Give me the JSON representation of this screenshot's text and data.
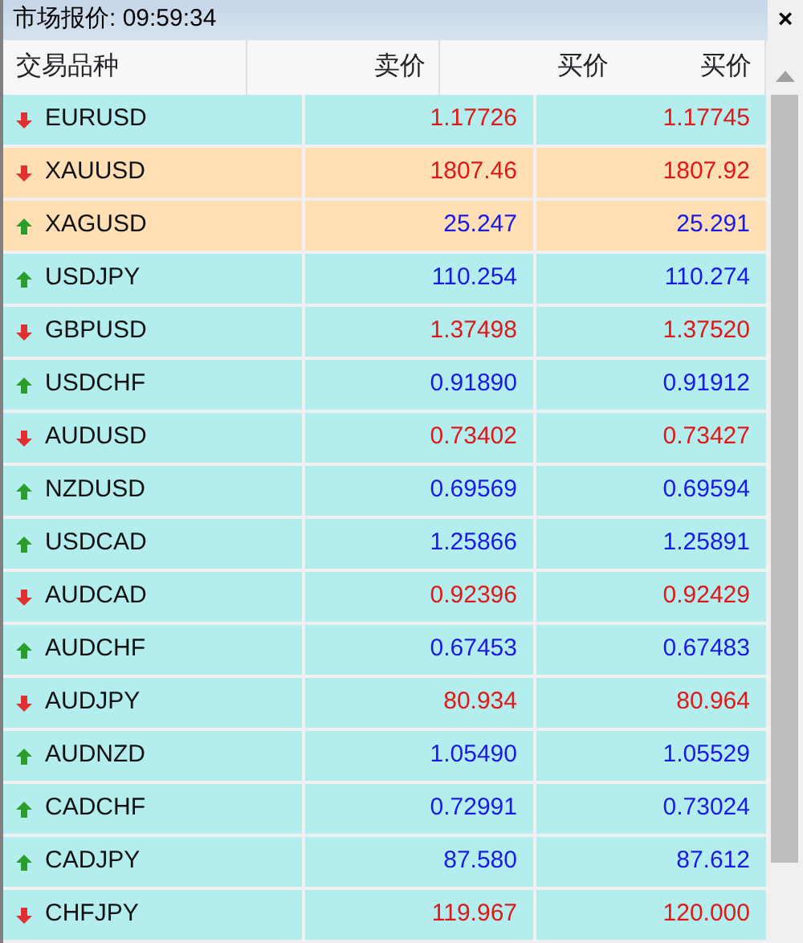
{
  "window": {
    "title": "市场报价: 09:59:34",
    "close": "×"
  },
  "columns": [
    "交易品种",
    "卖价",
    "买价",
    "买价"
  ],
  "rows": [
    {
      "symbol": "EURUSD",
      "kind": "down",
      "highlighted": false,
      "bid": "1.17726",
      "ask": "1.17745"
    },
    {
      "symbol": "XAUUSD",
      "kind": "down",
      "highlighted": true,
      "bid": "1807.46",
      "ask": "1807.92"
    },
    {
      "symbol": "XAGUSD",
      "kind": "up",
      "highlighted": true,
      "bid": "25.247",
      "ask": "25.291"
    },
    {
      "symbol": "USDJPY",
      "kind": "up",
      "highlighted": false,
      "bid": "110.254",
      "ask": "110.274"
    },
    {
      "symbol": "GBPUSD",
      "kind": "down",
      "highlighted": false,
      "bid": "1.37498",
      "ask": "1.37520"
    },
    {
      "symbol": "USDCHF",
      "kind": "up",
      "highlighted": false,
      "bid": "0.91890",
      "ask": "0.91912"
    },
    {
      "symbol": "AUDUSD",
      "kind": "down",
      "highlighted": false,
      "bid": "0.73402",
      "ask": "0.73427"
    },
    {
      "symbol": "NZDUSD",
      "kind": "up",
      "highlighted": false,
      "bid": "0.69569",
      "ask": "0.69594"
    },
    {
      "symbol": "USDCAD",
      "kind": "up",
      "highlighted": false,
      "bid": "1.25866",
      "ask": "1.25891"
    },
    {
      "symbol": "AUDCAD",
      "kind": "down",
      "highlighted": false,
      "bid": "0.92396",
      "ask": "0.92429"
    },
    {
      "symbol": "AUDCHF",
      "kind": "up",
      "highlighted": false,
      "bid": "0.67453",
      "ask": "0.67483"
    },
    {
      "symbol": "AUDJPY",
      "kind": "down",
      "highlighted": false,
      "bid": "80.934",
      "ask": "80.964"
    },
    {
      "symbol": "AUDNZD",
      "kind": "up",
      "highlighted": false,
      "bid": "1.05490",
      "ask": "1.05529"
    },
    {
      "symbol": "CADCHF",
      "kind": "up",
      "highlighted": false,
      "bid": "0.72991",
      "ask": "0.73024"
    },
    {
      "symbol": "CADJPY",
      "kind": "up",
      "highlighted": false,
      "bid": "87.580",
      "ask": "87.612"
    },
    {
      "symbol": "CHFJPY",
      "kind": "down",
      "highlighted": false,
      "bid": "119.967",
      "ask": "120.000"
    }
  ]
}
